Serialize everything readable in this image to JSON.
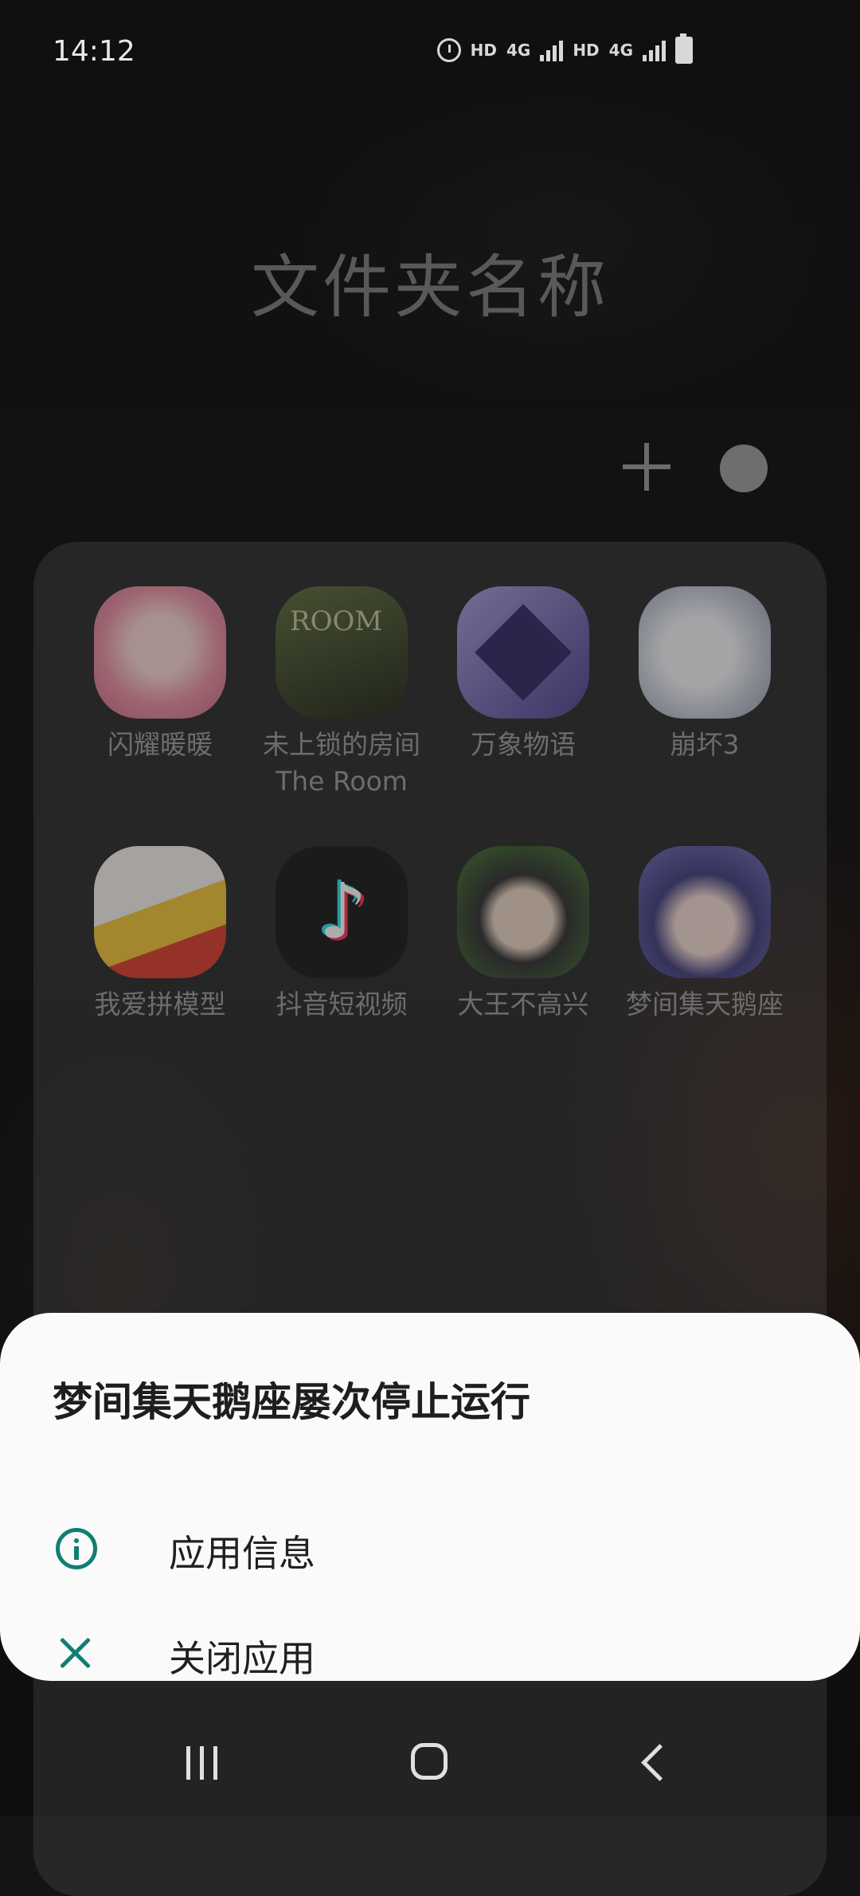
{
  "status_bar": {
    "time": "14:12",
    "net1": "HD",
    "net2": "HD",
    "gen1": "4G",
    "gen2": "4G"
  },
  "folder": {
    "title": "文件夹名称",
    "apps": [
      {
        "label": "闪耀暖暖",
        "icon": "shining-nikki-icon",
        "color": "#e7a3b0"
      },
      {
        "label": "未上锁的房间 The Room",
        "icon": "the-room-icon",
        "color": "#3c4a2a"
      },
      {
        "label": "万象物语",
        "icon": "sdorica-icon",
        "color": "#6a5aa8"
      },
      {
        "label": "崩坏3",
        "icon": "honkai-impact-icon",
        "color": "#c9ced8"
      },
      {
        "label": "我爱拼模型",
        "icon": "model-builder-icon",
        "color": "#e84a2a"
      },
      {
        "label": "抖音短视频",
        "icon": "douyin-icon",
        "color": "#111111"
      },
      {
        "label": "大王不高兴",
        "icon": "king-unhappy-icon",
        "color": "#3d6b2a"
      },
      {
        "label": "梦间集天鹅座",
        "icon": "dream-collection-icon",
        "color": "#4a4a9a"
      }
    ]
  },
  "dialog": {
    "title": "梦间集天鹅座屡次停止运行",
    "app_info_label": "应用信息",
    "close_app_label": "关闭应用",
    "accent": "#117e73"
  }
}
